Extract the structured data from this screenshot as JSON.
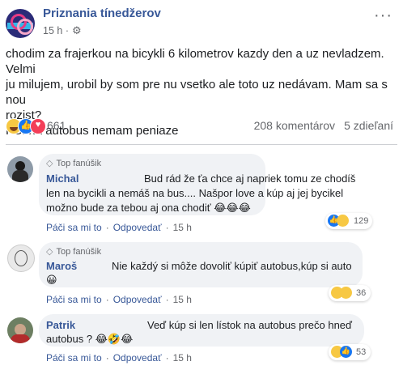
{
  "post": {
    "page_name": "Priznania tínedžerov",
    "time": "15 h",
    "icons": {
      "privacy": "gear-icon",
      "more": "more-dots-icon"
    },
    "text_line1": "chodim za frajerkou na bicykli 6 kilometrov kazdy den a uz nevladzem. Velmi",
    "text_line2": "ju milujem, urobil by som pre nu vsetko ale toto uz nedávam. Mam sa s nou",
    "text_line3": "rozist?",
    "text_line4": "PS: na autobus nemam peniaze",
    "reaction_count": "661",
    "comments_count": "208 komentárov",
    "shares_count": "5 zdieľaní"
  },
  "comments": [
    {
      "badge": "Top fanúšik",
      "name": "Michal",
      "line1": "Bud rád že ťa chce aj napriek tomu ze chodíš",
      "line2": "len na bycikli a nemáš na bus.... Našpor love a kúp aj jej bycikel",
      "line3": "možno bude za tebou aj ona chodiť 😂😂😂",
      "like": "Páči sa mi to",
      "reply": "Odpovedať",
      "time": "15 h",
      "reaction_count": "129"
    },
    {
      "badge": "Top fanúšik",
      "name": "Maroš",
      "line1": "Nie každý si môže dovoliť kúpiť autobus,kúp si auto",
      "line2": "😀",
      "like": "Páči sa mi to",
      "reply": "Odpovedať",
      "time": "15 h",
      "reaction_count": "36"
    },
    {
      "name": "Patrik",
      "line1": "Veď kúp si len lístok na autobus prečo hneď",
      "line2": "autobus ? 😂🤣😂",
      "like": "Páči sa mi to",
      "reply": "Odpovedať",
      "time": "15 h",
      "reaction_count": "53"
    }
  ]
}
